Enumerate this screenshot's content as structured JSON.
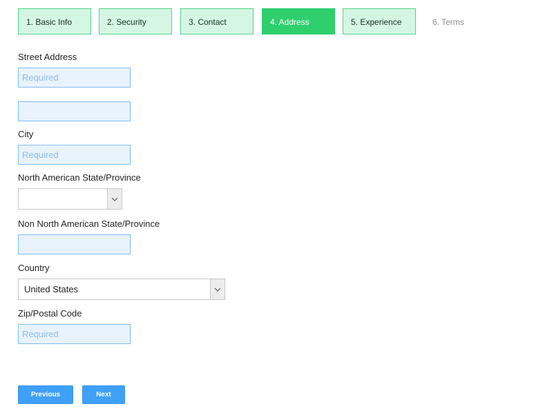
{
  "steps": [
    {
      "label": "1. Basic Info",
      "state": "done"
    },
    {
      "label": "2. Security",
      "state": "done"
    },
    {
      "label": "3. Contact",
      "state": "done"
    },
    {
      "label": "4. Address",
      "state": "active"
    },
    {
      "label": "5. Experience",
      "state": "done"
    },
    {
      "label": "6. Terms",
      "state": "pending"
    }
  ],
  "form": {
    "street_address": {
      "label": "Street Address",
      "placeholder": "Required",
      "value": ""
    },
    "street_address_2": {
      "placeholder": "",
      "value": ""
    },
    "city": {
      "label": "City",
      "placeholder": "Required",
      "value": ""
    },
    "na_state": {
      "label": "North American State/Province",
      "value": ""
    },
    "non_na_state": {
      "label": "Non North American State/Province",
      "placeholder": "",
      "value": ""
    },
    "country": {
      "label": "Country",
      "value": "United States"
    },
    "zip": {
      "label": "Zip/Postal Code",
      "placeholder": "Required",
      "value": ""
    }
  },
  "buttons": {
    "previous": "Previous",
    "next": "Next"
  },
  "colors": {
    "step_done_bg": "#d4f6e2",
    "step_done_border": "#4fd68b",
    "step_active": "#2fcf6e",
    "input_bg": "#e9f3fd",
    "input_border": "#7cbcf2",
    "button": "#3fa0f7"
  },
  "icons": {
    "select_arrow": "chevron-down-icon"
  }
}
